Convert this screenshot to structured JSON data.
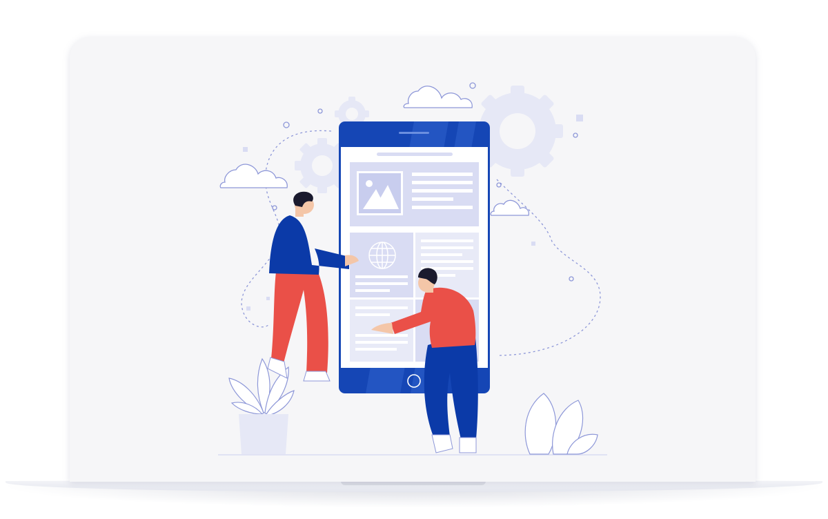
{
  "colors": {
    "primary_blue": "#1546b5",
    "deep_blue": "#0b3aa8",
    "coral": "#ea5048",
    "lavender": "#d9dcf3",
    "light_lavender": "#e8eaf7",
    "line": "#8d97d8",
    "screen_bg": "#f6f6f8",
    "hair": "#1a1a2e",
    "skin": "#f4c6a8",
    "white": "#ffffff"
  },
  "icons": [
    "image-placeholder-icon",
    "globe-icon",
    "gear-icon",
    "cloud-icon",
    "home-button-icon"
  ]
}
